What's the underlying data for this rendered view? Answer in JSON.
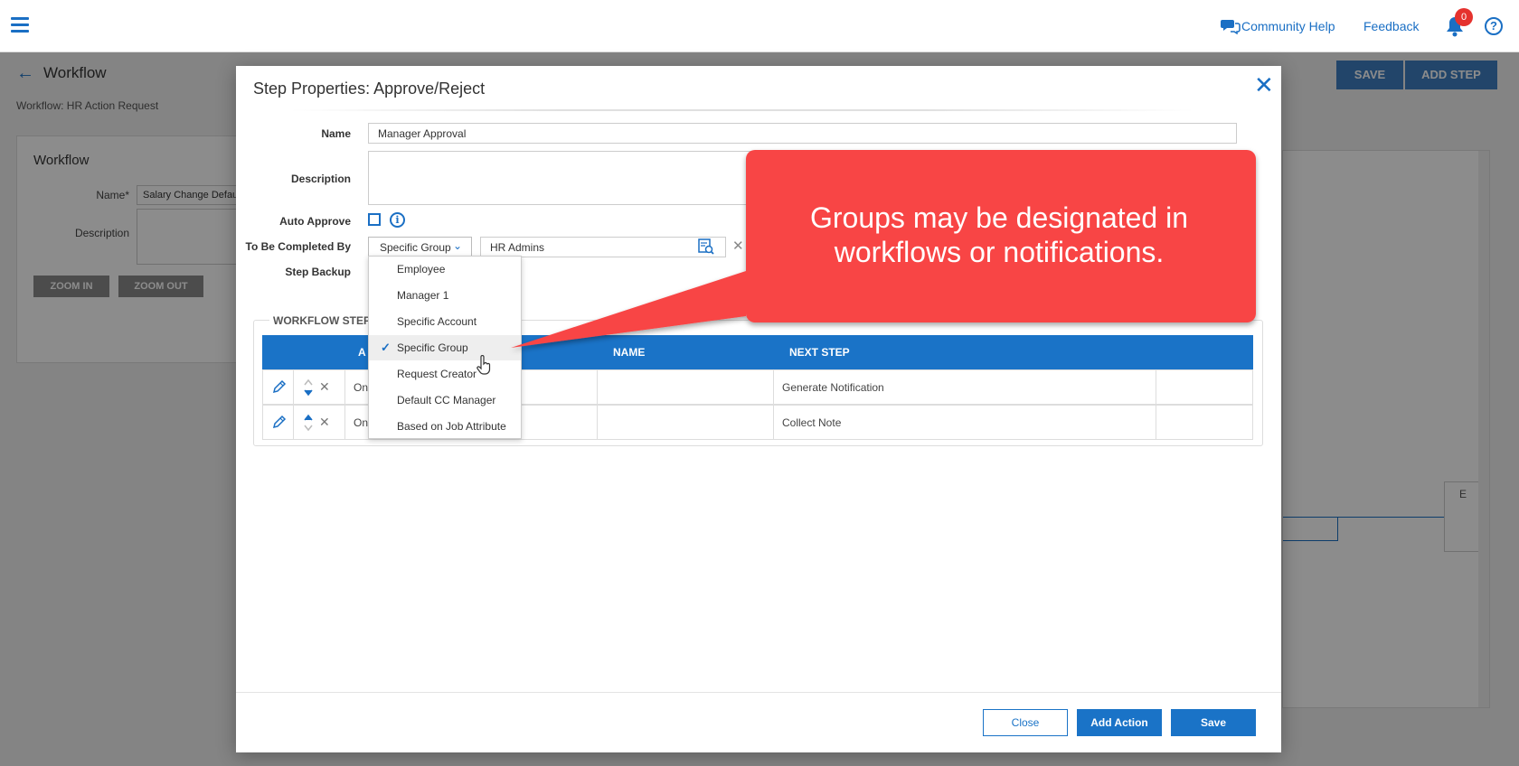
{
  "topbar": {
    "community_help": "Community Help",
    "feedback": "Feedback",
    "notification_count": "0",
    "help_glyph": "?"
  },
  "background": {
    "back_arrow": "←",
    "title": "Workflow",
    "subtitle": "Workflow: HR Action Request",
    "save": "SAVE",
    "add_step": "ADD STEP",
    "card_title": "Workflow",
    "name_label": "Name*",
    "name_value": "Salary Change Default W",
    "description_label": "Description",
    "zoom_in": "ZOOM IN",
    "zoom_out": "ZOOM OUT",
    "canvas_node": "E"
  },
  "modal": {
    "title": "Step Properties: Approve/Reject",
    "close_glyph": "✕",
    "name_label": "Name",
    "name_value": "Manager Approval",
    "description_label": "Description",
    "auto_approve_label": "Auto Approve",
    "completed_by_label": "To Be Completed By",
    "completed_by_value": "Specific Group",
    "group_value": "HR Admins",
    "step_backup_label": "Step Backup",
    "section_legend": "WORKFLOW STEP AC",
    "table": {
      "headers": [
        "A",
        "NAME",
        "NEXT STEP"
      ],
      "rows": [
        {
          "action": "On",
          "name": "",
          "next_step": "Generate Notification"
        },
        {
          "action": "On",
          "name": "",
          "next_step": "Collect Note"
        }
      ]
    },
    "dropdown_options": [
      "Employee",
      "Manager 1",
      "Specific Account",
      "Specific Group",
      "Request Creator",
      "Default CC Manager",
      "Based on Job Attribute"
    ],
    "selected_option": "Specific Group",
    "buttons": {
      "close": "Close",
      "add_action": "Add Action",
      "save": "Save"
    }
  },
  "callout": {
    "line1": "Groups may be designated in",
    "line2": "workflows or notifications.",
    "color": "#f84444"
  },
  "colors": {
    "accent": "#1a73c7",
    "badge": "#e5322e"
  }
}
